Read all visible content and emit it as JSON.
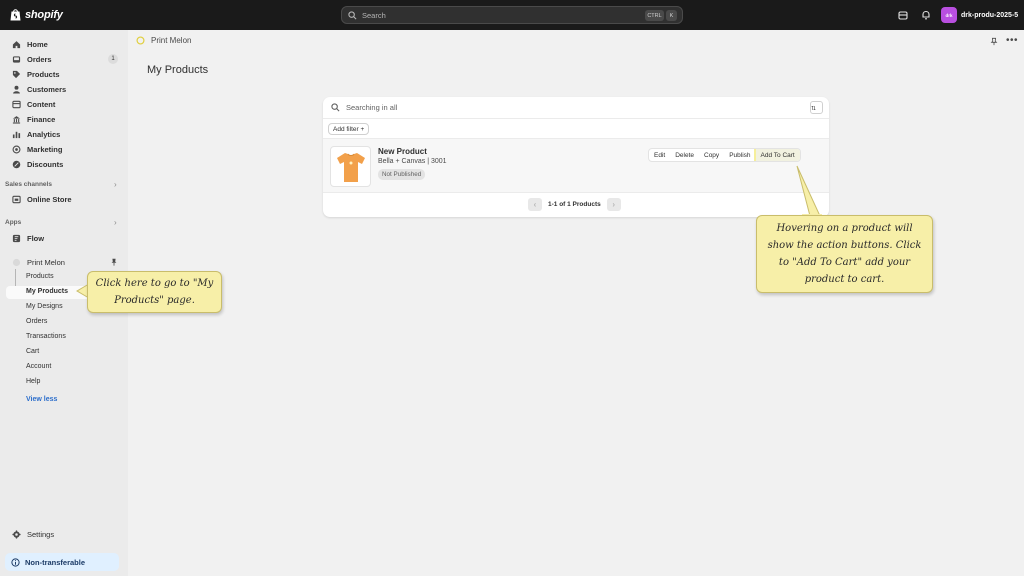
{
  "topbar": {
    "brand": "shopify",
    "search_placeholder": "Search",
    "kbd_ctrl": "CTRL",
    "kbd_k": "K",
    "avatar_initials": "drk",
    "store_name": "drk-produ-2025-5"
  },
  "sidebar": {
    "items": [
      {
        "label": "Home",
        "icon": "home-icon"
      },
      {
        "label": "Orders",
        "icon": "inbox-icon",
        "badge": "1"
      },
      {
        "label": "Products",
        "icon": "tag-icon"
      },
      {
        "label": "Customers",
        "icon": "person-icon"
      },
      {
        "label": "Content",
        "icon": "content-icon"
      },
      {
        "label": "Finance",
        "icon": "bank-icon"
      },
      {
        "label": "Analytics",
        "icon": "bar-chart-icon"
      },
      {
        "label": "Marketing",
        "icon": "target-icon"
      },
      {
        "label": "Discounts",
        "icon": "discount-icon"
      }
    ],
    "sales_channels_label": "Sales channels",
    "online_store": "Online Store",
    "apps_label": "Apps",
    "flow": "Flow",
    "app_name": "Print Melon",
    "app_subitems": [
      "Products",
      "My Products",
      "My Designs",
      "Orders",
      "Transactions",
      "Cart",
      "Account",
      "Help"
    ],
    "view_less": "View less",
    "settings": "Settings",
    "non_transferable": "Non-transferable"
  },
  "main": {
    "app_header": "Print Melon",
    "page_title": "My Products",
    "search_placeholder": "Searching in all",
    "add_filter": "Add filter +",
    "product": {
      "name": "New Product",
      "subtitle": "Bella + Canvas | 3001",
      "status": "Not Published"
    },
    "actions": [
      "Edit",
      "Delete",
      "Copy",
      "Publish",
      "Add To Cart"
    ],
    "pagination": "1-1 of 1 Products"
  },
  "callouts": {
    "left": "Click here to go to \"My Products\" page.",
    "right": "Hovering on a product will show the action buttons. Click to \"Add To Cart\" add your product to cart."
  },
  "colors": {
    "topbar_bg": "#1a1a1a",
    "sidebar_bg": "#ebebeb",
    "main_bg": "#f1f1f1",
    "callout_bg": "#f7efa8",
    "link": "#2c6ecb",
    "avatar": "#b94fe0",
    "product_orange": "#f2a04a"
  }
}
